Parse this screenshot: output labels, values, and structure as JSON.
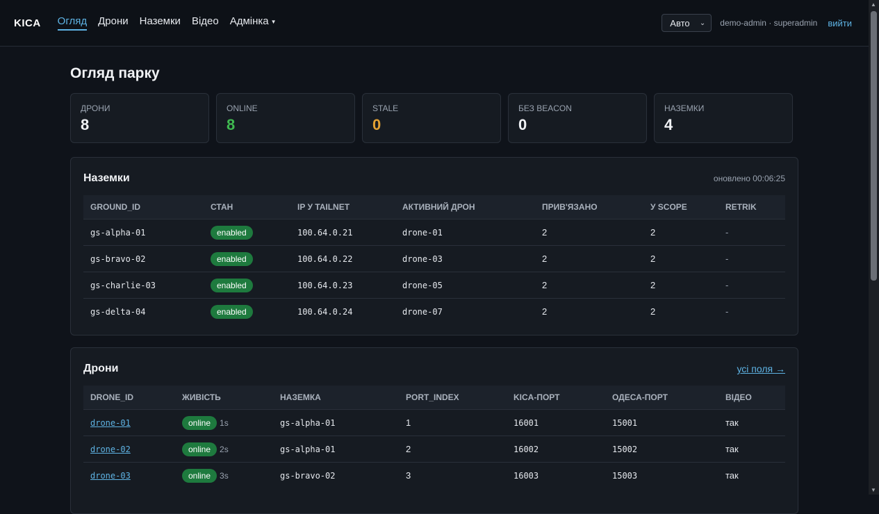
{
  "nav": {
    "brand": "KICA",
    "links": [
      {
        "label": "Огляд"
      },
      {
        "label": "Дрони"
      },
      {
        "label": "Наземки"
      },
      {
        "label": "Відео"
      },
      {
        "label": "Адмінка"
      }
    ],
    "theme_select": "Авто",
    "user": "demo-admin · superadmin",
    "logout": "вийти"
  },
  "page_title": "Огляд парку",
  "stats": [
    {
      "label": "ДРОНИ",
      "value": "8"
    },
    {
      "label": "ONLINE",
      "value": "8",
      "color": "#3fb950"
    },
    {
      "label": "STALE",
      "value": "0",
      "color": "#e3a133"
    },
    {
      "label": "БЕЗ BEACON",
      "value": "0"
    },
    {
      "label": "НАЗЕМКИ",
      "value": "4"
    }
  ],
  "grounds": {
    "title": "Наземки",
    "updated": "оновлено 00:06:25",
    "columns": [
      "GROUND_ID",
      "СТАН",
      "IP У TAILNET",
      "АКТИВНИЙ ДРОН",
      "ПРИВ'ЯЗАНО",
      "У SCOPE",
      "RETRIK"
    ],
    "rows": [
      {
        "id": "gs-alpha-01",
        "state": "enabled",
        "ip": "100.64.0.21",
        "drone": "drone-01",
        "bound": "2",
        "scope": "2",
        "retrik": "-"
      },
      {
        "id": "gs-bravo-02",
        "state": "enabled",
        "ip": "100.64.0.22",
        "drone": "drone-03",
        "bound": "2",
        "scope": "2",
        "retrik": "-"
      },
      {
        "id": "gs-charlie-03",
        "state": "enabled",
        "ip": "100.64.0.23",
        "drone": "drone-05",
        "bound": "2",
        "scope": "2",
        "retrik": "-"
      },
      {
        "id": "gs-delta-04",
        "state": "enabled",
        "ip": "100.64.0.24",
        "drone": "drone-07",
        "bound": "2",
        "scope": "2",
        "retrik": "-"
      }
    ]
  },
  "drones": {
    "title": "Дрони",
    "all_fields": "усі поля →",
    "columns": [
      "DRONE_ID",
      "ЖИВІСТЬ",
      "НАЗЕМКА",
      "PORT_INDEX",
      "KICA-ПОРТ",
      "ОДЕСА-ПОРТ",
      "ВІДЕО"
    ],
    "rows": [
      {
        "id": "drone-01",
        "status": "online",
        "age": "1s",
        "ground": "gs-alpha-01",
        "port_index": "1",
        "kica_port": "16001",
        "odesa_port": "15001",
        "video": "так"
      },
      {
        "id": "drone-02",
        "status": "online",
        "age": "2s",
        "ground": "gs-alpha-01",
        "port_index": "2",
        "kica_port": "16002",
        "odesa_port": "15002",
        "video": "так"
      },
      {
        "id": "drone-03",
        "status": "online",
        "age": "3s",
        "ground": "gs-bravo-02",
        "port_index": "3",
        "kica_port": "16003",
        "odesa_port": "15003",
        "video": "так"
      }
    ]
  }
}
